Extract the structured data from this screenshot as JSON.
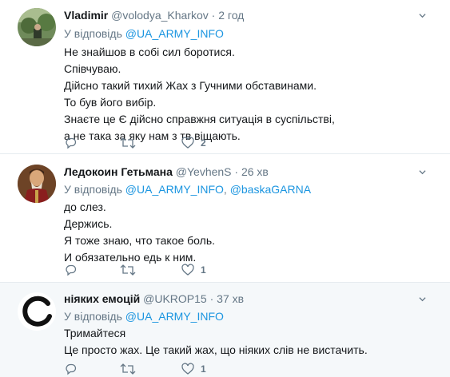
{
  "tweets": [
    {
      "name": "Vladimir",
      "handle": "@volodya_Kharkov",
      "sep": "·",
      "time": "2 год",
      "reply_prefix": "У відповідь",
      "reply_to": [
        "@UA_ARMY_INFO"
      ],
      "body": [
        "Не знайшов в собі сил боротися.",
        "Співчуваю.",
        "Дійсно такий тихий Жах з Гучними обставинами.",
        "То був його вибір.",
        "Знаєте це Є дійсно справжня ситуація в суспільстві,",
        "а не така за яку нам з тв віщають."
      ],
      "likes": "2"
    },
    {
      "name": "Ледокоин Гетьмана",
      "handle": "@YevhenS",
      "sep": "·",
      "time": "26 хв",
      "reply_prefix": "У відповідь",
      "reply_to": [
        "@UA_ARMY_INFO",
        "@baskaGARNA"
      ],
      "reply_sep": ", ",
      "body": [
        "до слез.",
        "Держись.",
        "Я тоже знаю, что такое боль.",
        "И обязательно едь к ним."
      ],
      "likes": "1"
    },
    {
      "name": "ніяких емоцій",
      "handle": "@UKROP15",
      "sep": "·",
      "time": "37 хв",
      "reply_prefix": "У відповідь",
      "reply_to": [
        "@UA_ARMY_INFO"
      ],
      "body": [
        "Тримайтеся",
        "Це просто жах. Це такий жах, що ніяких слів не вистачить."
      ],
      "likes": "1"
    }
  ],
  "colors": {
    "link": "#1b95e0",
    "muted": "#657786",
    "text": "#14171a",
    "highlight": "#f5f8fa"
  },
  "icons": [
    "chevron-down-icon",
    "reply-icon",
    "retweet-icon",
    "like-icon"
  ]
}
